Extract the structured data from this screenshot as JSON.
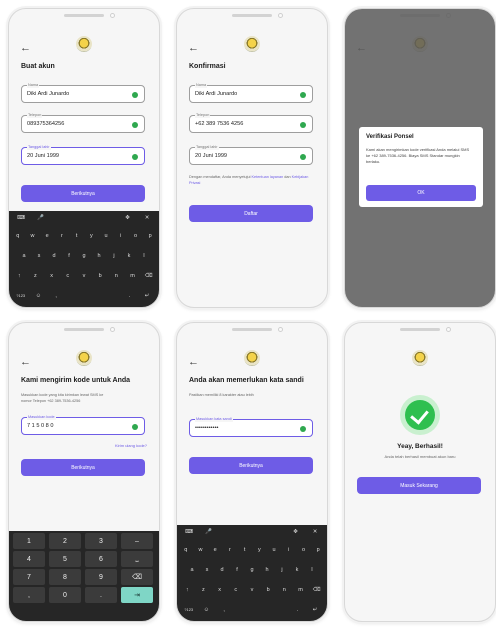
{
  "screen1": {
    "title": "Buat akun",
    "name_label": "Nama",
    "name_value": "Diki Ardi Junardo",
    "phone_label": "Telepon",
    "phone_value": "089375364256",
    "dob_label": "Tanggal lahir",
    "dob_value": "20 Juni 1999",
    "button": "Berikutnya",
    "kbd_row1": [
      "q",
      "w",
      "e",
      "r",
      "t",
      "y",
      "u",
      "i",
      "o",
      "p"
    ],
    "kbd_row2": [
      "a",
      "s",
      "d",
      "f",
      "g",
      "h",
      "j",
      "k",
      "l"
    ],
    "kbd_row3": [
      "↑",
      "z",
      "x",
      "c",
      "v",
      "b",
      "n",
      "m",
      "⌫"
    ],
    "kbd_row4": [
      "?123",
      "☺",
      ",",
      "",
      ".",
      "↵"
    ]
  },
  "screen2": {
    "title": "Konfirmasi",
    "name_label": "Nama",
    "name_value": "Diki Ardi Junardo",
    "phone_label": "Telepon",
    "phone_value": "+62 389 7536 4256",
    "dob_label": "Tanggal lahir",
    "dob_value": "20 Juni 1999",
    "terms_prefix": "Dengan mendaftar, Anda menyetujui",
    "terms_link1": "Ketentuan",
    "terms_mid": "layanan",
    "terms_and": "dan",
    "terms_link2": "Kebijakan Privasi",
    "button": "Daftar"
  },
  "screen3": {
    "dialog_title": "Verifikasi Ponsel",
    "dialog_body": "Kami akan mengirimkan kode verifikasi Anda melalui SMS ke +62 389-7536-4256. Biaya SMS Standar mungkin berlaku.",
    "dialog_button": "OK"
  },
  "screen4": {
    "title": "Kami mengirim kode untuk Anda",
    "subtitle": "Masukkan kode yang kita kirimkan lewat SMS ke",
    "subtitle2": "nomor Telepon +62 389-7536-4256",
    "code_label": "Masukkan kode",
    "code_value": "7 1 5 0 8 0",
    "resend": "Kirim ulang kode?",
    "button": "Berikutnya",
    "numpad": [
      "1",
      "2",
      "3",
      "–",
      "4",
      "5",
      "6",
      "⎵",
      "7",
      "8",
      "9",
      "⌫",
      ",",
      "0",
      ".",
      "⇥"
    ]
  },
  "screen5": {
    "title": "Anda akan memerlukan kata sandi",
    "subtitle": "Pastikan memiliki 8 karakter atau lebih",
    "pw_label": "Masukkan kata sandi",
    "pw_value": "••••••••••••",
    "button": "Berikutnya",
    "kbd_row1": [
      "q",
      "w",
      "e",
      "r",
      "t",
      "y",
      "u",
      "i",
      "o",
      "p"
    ],
    "kbd_row2": [
      "a",
      "s",
      "d",
      "f",
      "g",
      "h",
      "j",
      "k",
      "l"
    ],
    "kbd_row3": [
      "↑",
      "z",
      "x",
      "c",
      "v",
      "b",
      "n",
      "m",
      "⌫"
    ],
    "kbd_row4": [
      "?123",
      "☺",
      ",",
      "",
      ".",
      "↵"
    ]
  },
  "screen6": {
    "headline": "Yeay, Berhasil!",
    "message": "Anda telah berhasil membuat akun baru",
    "button": "Masuk Sekarang"
  },
  "colors": {
    "accent": "#6e5ce6",
    "success": "#2fbf4f",
    "keyboard": "#262626"
  },
  "icons": [
    "back-arrow-icon",
    "logo-icon",
    "check-circle-icon",
    "success-check-icon",
    "backspace-icon",
    "shift-icon"
  ]
}
